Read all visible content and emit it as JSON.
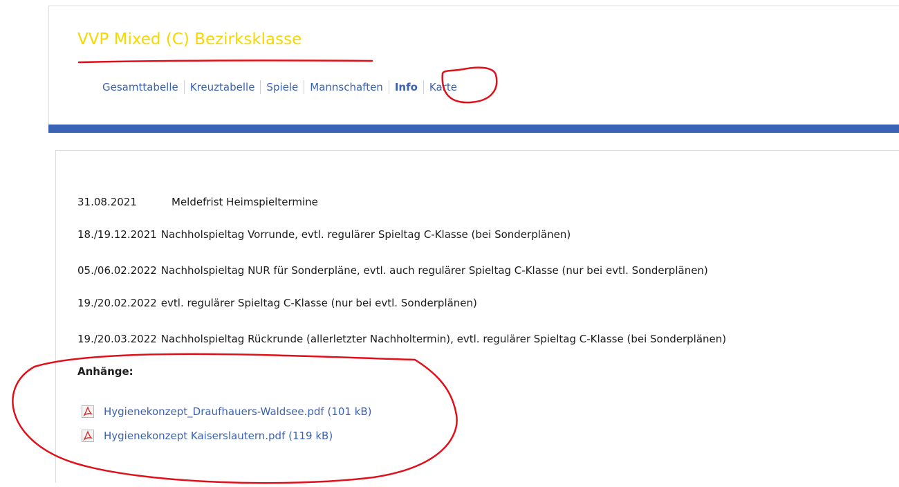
{
  "title": "VVP Mixed (C) Bezirksklasse",
  "tabs": [
    {
      "label": "Gesamttabelle"
    },
    {
      "label": "Kreuztabelle"
    },
    {
      "label": "Spiele"
    },
    {
      "label": "Mannschaften"
    },
    {
      "label": "Info",
      "active": true
    },
    {
      "label": "Karte"
    }
  ],
  "info": {
    "entries": [
      {
        "date": "31.08.2021",
        "text": "Meldefrist Heimspieltermine"
      },
      {
        "date": "18./19.12.2021",
        "text": "Nachholspieltag Vorrunde, evtl. regulärer Spieltag C-Klasse (bei Sonderplänen)"
      },
      {
        "date": "05./06.02.2022",
        "text": "Nachholspieltag NUR für Sonderpläne, evtl. auch regulärer Spieltag C-Klasse (nur bei evtl. Sonderplänen)"
      },
      {
        "date": "19./20.02.2022",
        "text": "evtl. regulärer Spieltag C-Klasse (nur bei evtl. Sonderplänen)"
      },
      {
        "date": "19./20.03.2022",
        "text": "Nachholspieltag  Rückrunde  (allerletzter Nachholtermin), evtl. regulärer Spieltag C-Klasse (bei Sonderplänen)"
      }
    ]
  },
  "attachments": {
    "heading": "Anhänge:",
    "files": [
      {
        "name": "Hygienekonzept_Draufhauers-Waldsee.pdf (101 kB)",
        "icon": "pdf-icon"
      },
      {
        "name": "Hygienekonzept Kaiserslautern.pdf (119 kB)",
        "icon": "pdf-icon"
      }
    ]
  },
  "colors": {
    "title": "#f5d800",
    "link": "#3a63b5",
    "accent_bar": "#3a63b5",
    "annotation": "#e0101a"
  }
}
